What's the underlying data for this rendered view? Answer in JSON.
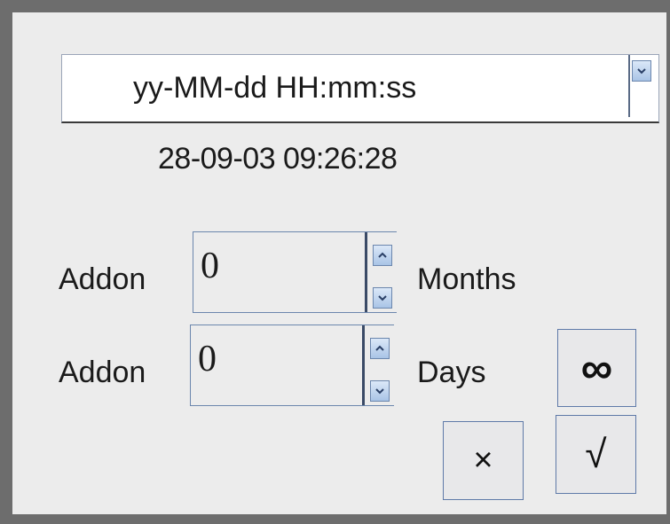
{
  "date_format": {
    "selected": "yy-MM-dd HH:mm:ss"
  },
  "current_datetime": "28-09-03 09:26:28",
  "addon_months": {
    "label": "Addon",
    "value": "0",
    "unit": "Months"
  },
  "addon_days": {
    "label": "Addon",
    "value": "0",
    "unit": "Days"
  },
  "buttons": {
    "infinity": "∞",
    "cancel": "×",
    "confirm": "√"
  },
  "colors": {
    "background": "#6d6d6d",
    "panel": "#ececec",
    "accent": "#6b86ad"
  },
  "icons": {
    "dropdown": "chevron-down-icon",
    "increment": "chevron-up-icon",
    "decrement": "chevron-down-icon"
  }
}
